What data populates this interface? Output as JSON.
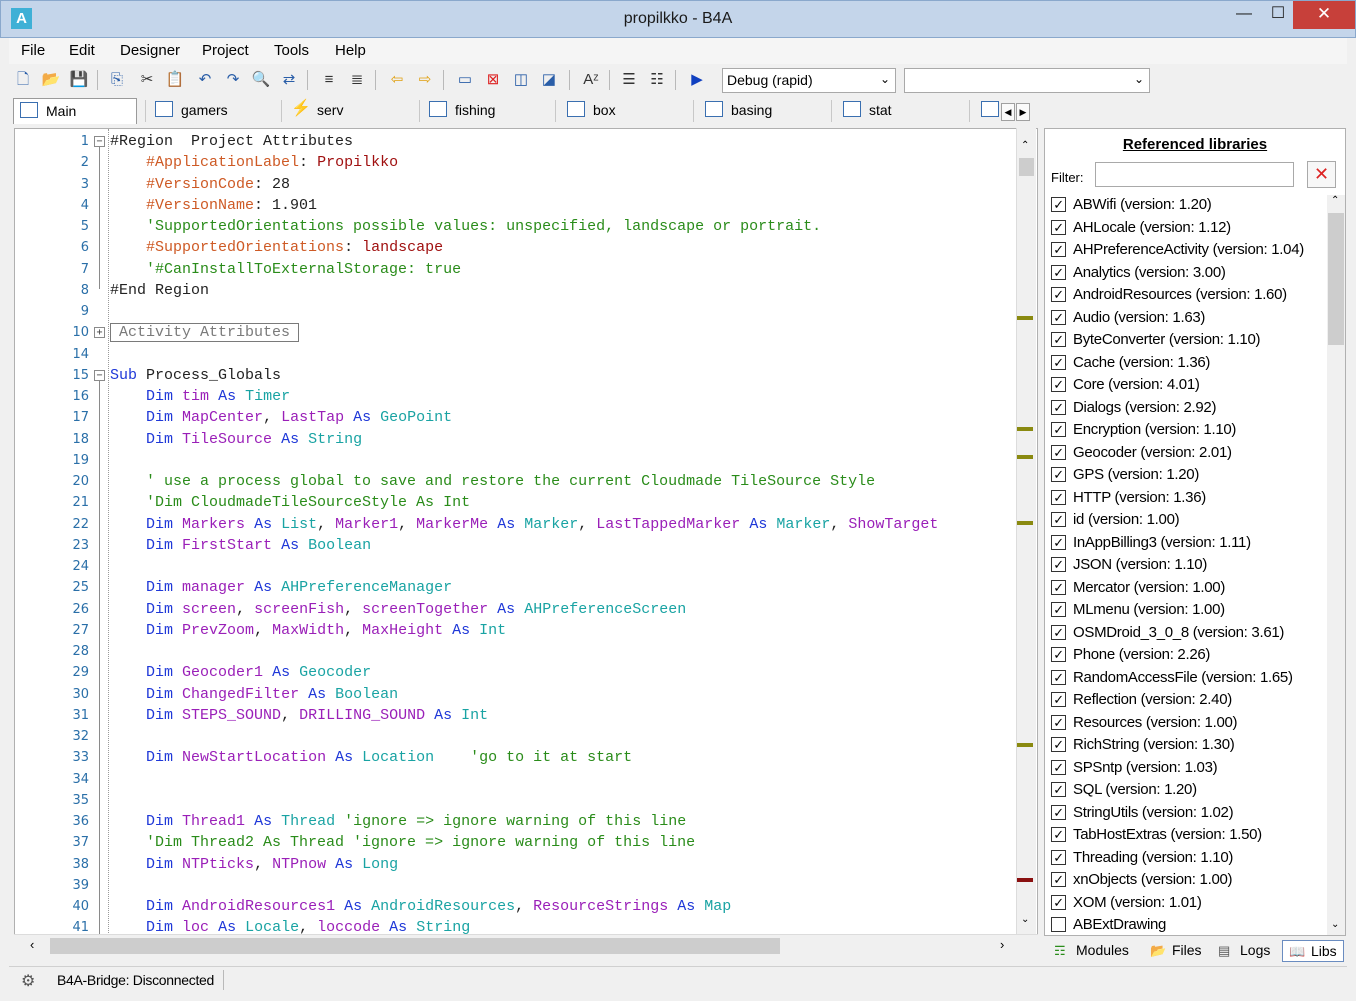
{
  "window": {
    "title": "propilkko - B4A",
    "app_icon": "A",
    "minimize": "—",
    "maximize": "☐",
    "close": "✕"
  },
  "menu": [
    "File",
    "Edit",
    "Designer",
    "Project",
    "Tools",
    "Help"
  ],
  "toolbar": {
    "build_config": "Debug (rapid)",
    "second_combo": ""
  },
  "module_tabs": [
    "Main",
    "gamers",
    "serv",
    "fishing",
    "box",
    "basing",
    "stat"
  ],
  "editor": {
    "lines": [
      {
        "n": "1",
        "html": "<span class='pl'>#Region  Project Attributes</span>",
        "fold": "-"
      },
      {
        "n": "2",
        "html": "    <span class='dr'>#ApplicationLabel</span><span class='pl'>: </span><span class='st'>Propilkko</span>"
      },
      {
        "n": "3",
        "html": "    <span class='dr'>#VersionCode</span><span class='pl'>: 28</span>"
      },
      {
        "n": "4",
        "html": "    <span class='dr'>#VersionName</span><span class='pl'>: 1.901</span>"
      },
      {
        "n": "5",
        "html": "    <span class='cm'>'SupportedOrientations possible values: unspecified, landscape or portrait.</span>"
      },
      {
        "n": "6",
        "html": "    <span class='dr'>#SupportedOrientations</span><span class='pl'>: </span><span class='st'>landscape</span>"
      },
      {
        "n": "7",
        "html": "    <span class='cm'>'#CanInstallToExternalStorage: true</span>"
      },
      {
        "n": "8",
        "html": "<span class='pl'>#End Region</span>"
      },
      {
        "n": "9",
        "html": ""
      },
      {
        "n": "10",
        "html": "<span class='collapsed-box'>Activity Attributes</span>",
        "fold": "+"
      },
      {
        "n": "14",
        "html": ""
      },
      {
        "n": "15",
        "html": "<span class='kw'>Sub</span><span class='pl'> Process_Globals</span>",
        "fold": "-"
      },
      {
        "n": "16",
        "html": "    <span class='kw'>Dim</span> <span class='id'>tim</span> <span class='kw'>As</span> <span class='ty'>Timer</span>"
      },
      {
        "n": "17",
        "html": "    <span class='kw'>Dim</span> <span class='id'>MapCenter</span><span class='pl'>, </span><span class='id'>LastTap</span> <span class='kw'>As</span> <span class='ty'>GeoPoint</span>"
      },
      {
        "n": "18",
        "html": "    <span class='kw'>Dim</span> <span class='id'>TileSource</span> <span class='kw'>As</span> <span class='ty'>String</span>"
      },
      {
        "n": "19",
        "html": ""
      },
      {
        "n": "20",
        "html": "    <span class='cm'>' use a process global to save and restore the current Cloudmade TileSource Style</span>"
      },
      {
        "n": "21",
        "html": "    <span class='cm'>'Dim CloudmadeTileSourceStyle As Int</span>"
      },
      {
        "n": "22",
        "html": "    <span class='kw'>Dim</span> <span class='id'>Markers</span> <span class='kw'>As</span> <span class='ty'>List</span><span class='pl'>, </span><span class='id'>Marker1</span><span class='pl'>, </span><span class='id'>MarkerMe</span> <span class='kw'>As</span> <span class='ty'>Marker</span><span class='pl'>, </span><span class='id'>LastTappedMarker</span> <span class='kw'>As</span> <span class='ty'>Marker</span><span class='pl'>, </span><span class='id'>ShowTarget</span>"
      },
      {
        "n": "23",
        "html": "    <span class='kw'>Dim</span> <span class='id'>FirstStart</span> <span class='kw'>As</span> <span class='ty'>Boolean</span>"
      },
      {
        "n": "24",
        "html": ""
      },
      {
        "n": "25",
        "html": "    <span class='kw'>Dim</span> <span class='id'>manager</span> <span class='kw'>As</span> <span class='ty'>AHPreferenceManager</span>"
      },
      {
        "n": "26",
        "html": "    <span class='kw'>Dim</span> <span class='id'>screen</span><span class='pl'>, </span><span class='id'>screenFish</span><span class='pl'>, </span><span class='id'>screenTogether</span> <span class='kw'>As</span> <span class='ty'>AHPreferenceScreen</span>"
      },
      {
        "n": "27",
        "html": "    <span class='kw'>Dim</span> <span class='id'>PrevZoom</span><span class='pl'>, </span><span class='id'>MaxWidth</span><span class='pl'>, </span><span class='id'>MaxHeight</span> <span class='kw'>As</span> <span class='ty'>Int</span>"
      },
      {
        "n": "28",
        "html": ""
      },
      {
        "n": "29",
        "html": "    <span class='kw'>Dim</span> <span class='id'>Geocoder1</span> <span class='kw'>As</span> <span class='ty'>Geocoder</span>"
      },
      {
        "n": "30",
        "html": "    <span class='kw'>Dim</span> <span class='id'>ChangedFilter</span> <span class='kw'>As</span> <span class='ty'>Boolean</span>"
      },
      {
        "n": "31",
        "html": "    <span class='kw'>Dim</span> <span class='id'>STEPS_SOUND</span><span class='pl'>, </span><span class='id'>DRILLING_SOUND</span> <span class='kw'>As</span> <span class='ty'>Int</span>"
      },
      {
        "n": "32",
        "html": ""
      },
      {
        "n": "33",
        "html": "    <span class='kw'>Dim</span> <span class='id'>NewStartLocation</span> <span class='kw'>As</span> <span class='ty'>Location</span>    <span class='cm'>'go to it at start</span>"
      },
      {
        "n": "34",
        "html": ""
      },
      {
        "n": "35",
        "html": ""
      },
      {
        "n": "36",
        "html": "    <span class='kw'>Dim</span> <span class='id'>Thread1</span> <span class='kw'>As</span> <span class='ty'>Thread</span> <span class='cm'>'ignore =&gt; ignore warning of this line</span>"
      },
      {
        "n": "37",
        "html": "    <span class='cm'>'Dim Thread2 As Thread 'ignore =&gt; ignore warning of this line</span>"
      },
      {
        "n": "38",
        "html": "    <span class='kw'>Dim</span> <span class='id'>NTPticks</span><span class='pl'>, </span><span class='id'>NTPnow</span> <span class='kw'>As</span> <span class='ty'>Long</span>"
      },
      {
        "n": "39",
        "html": ""
      },
      {
        "n": "40",
        "html": "    <span class='kw'>Dim</span> <span class='id'>AndroidResources1</span> <span class='kw'>As</span> <span class='ty'>AndroidResources</span><span class='pl'>, </span><span class='id'>ResourceStrings</span> <span class='kw'>As</span> <span class='ty'>Map</span>"
      },
      {
        "n": "41",
        "html": "    <span class='kw'>Dim</span> <span class='id'>loc</span> <span class='kw'>As</span> <span class='ty'>Locale</span><span class='pl'>, </span><span class='id'>loccode</span> <span class='kw'>As</span> <span class='ty'>String</span>"
      }
    ]
  },
  "libraries": {
    "title": "Referenced libraries",
    "filter_label": "Filter:",
    "filter_value": "",
    "clear_icon": "✕",
    "items": [
      {
        "label": "ABWifi (version: 1.20)",
        "checked": true
      },
      {
        "label": "AHLocale (version: 1.12)",
        "checked": true
      },
      {
        "label": "AHPreferenceActivity (version: 1.04)",
        "checked": true
      },
      {
        "label": "Analytics (version: 3.00)",
        "checked": true
      },
      {
        "label": "AndroidResources (version: 1.60)",
        "checked": true
      },
      {
        "label": "Audio (version: 1.63)",
        "checked": true
      },
      {
        "label": "ByteConverter (version: 1.10)",
        "checked": true
      },
      {
        "label": "Cache (version: 1.36)",
        "checked": true
      },
      {
        "label": "Core (version: 4.01)",
        "checked": true
      },
      {
        "label": "Dialogs (version: 2.92)",
        "checked": true
      },
      {
        "label": "Encryption (version: 1.10)",
        "checked": true
      },
      {
        "label": "Geocoder (version: 2.01)",
        "checked": true
      },
      {
        "label": "GPS (version: 1.20)",
        "checked": true
      },
      {
        "label": "HTTP (version: 1.36)",
        "checked": true
      },
      {
        "label": "id (version: 1.00)",
        "checked": true
      },
      {
        "label": "InAppBilling3 (version: 1.11)",
        "checked": true
      },
      {
        "label": "JSON (version: 1.10)",
        "checked": true
      },
      {
        "label": "Mercator (version: 1.00)",
        "checked": true
      },
      {
        "label": "MLmenu (version: 1.00)",
        "checked": true
      },
      {
        "label": "OSMDroid_3_0_8 (version: 3.61)",
        "checked": true
      },
      {
        "label": "Phone (version: 2.26)",
        "checked": true
      },
      {
        "label": "RandomAccessFile (version: 1.65)",
        "checked": true
      },
      {
        "label": "Reflection (version: 2.40)",
        "checked": true
      },
      {
        "label": "Resources (version: 1.00)",
        "checked": true
      },
      {
        "label": "RichString (version: 1.30)",
        "checked": true
      },
      {
        "label": "SPSntp (version: 1.03)",
        "checked": true
      },
      {
        "label": "SQL (version: 1.20)",
        "checked": true
      },
      {
        "label": "StringUtils (version: 1.02)",
        "checked": true
      },
      {
        "label": "TabHostExtras (version: 1.50)",
        "checked": true
      },
      {
        "label": "Threading (version: 1.10)",
        "checked": true
      },
      {
        "label": "xnObjects (version: 1.00)",
        "checked": true
      },
      {
        "label": "XOM (version: 1.01)",
        "checked": true
      },
      {
        "label": "ABExtDrawing",
        "checked": false
      }
    ]
  },
  "right_tabs": [
    "Modules",
    "Files",
    "Logs",
    "Libs"
  ],
  "status": {
    "text": "B4A-Bridge: Disconnected"
  },
  "colors": {
    "keyword": "#1f38d8",
    "type": "#19a3a3",
    "identifier": "#9a1fb8",
    "comment": "#2a8c1a",
    "directive": "#ce5a25",
    "string": "#a01010",
    "line_number": "#2a6fa8"
  }
}
